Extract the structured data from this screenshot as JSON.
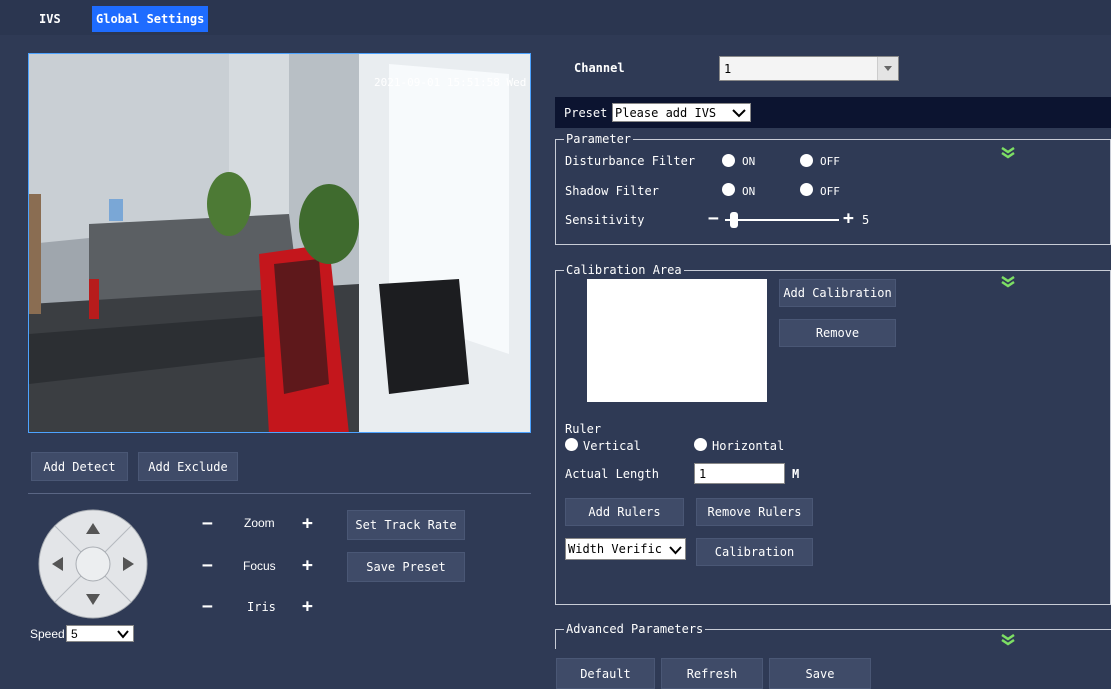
{
  "tabs": [
    {
      "label": "IVS"
    },
    {
      "label": "Global Settings"
    }
  ],
  "video": {
    "timestamp": "2021-09-01 15:51:58 Wed"
  },
  "detect": {
    "add_detect": "Add Detect",
    "add_exclude": "Add Exclude"
  },
  "ptz": {
    "zoom_label": "Zoom",
    "focus_label": "Focus",
    "iris_label": "Iris",
    "set_track_rate": "Set Track Rate",
    "save_preset": "Save Preset",
    "speed_label": "Speed",
    "speed_value": "5",
    "minus": "−",
    "plus": "+"
  },
  "channel": {
    "label": "Channel",
    "value": "1"
  },
  "preset": {
    "label": "Preset",
    "value": "Please add IVS"
  },
  "parameter": {
    "legend": "Parameter",
    "disturbance_filter": "Disturbance Filter",
    "shadow_filter": "Shadow Filter",
    "sensitivity": "Sensitivity",
    "on": "ON",
    "off": "OFF",
    "sensitivity_value": "5",
    "sensitivity_fraction": 0.05
  },
  "calibration": {
    "legend": "Calibration Area",
    "add_calibration": "Add Calibration",
    "remove": "Remove",
    "ruler": "Ruler",
    "vertical": "Vertical",
    "horizontal": "Horizontal",
    "actual_length_label": "Actual Length",
    "actual_length_value": "1",
    "unit": "M",
    "add_rulers": "Add Rulers",
    "remove_rulers": "Remove Rulers",
    "width_select": "Width Verific",
    "calibration_button": "Calibration"
  },
  "advanced": {
    "legend": "Advanced Parameters"
  },
  "footer": {
    "default": "Default",
    "refresh": "Refresh",
    "save": "Save"
  },
  "colors": {
    "background": "#2f3a55",
    "active_tab": "#1e6cff",
    "chevron": "#7ddf64"
  }
}
